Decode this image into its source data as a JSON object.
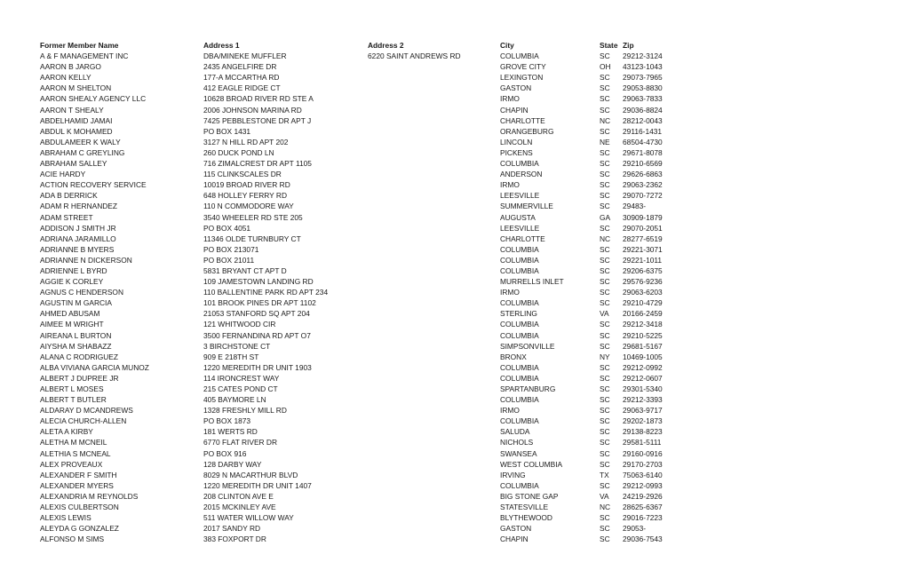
{
  "headers": {
    "name": "Former Member Name",
    "address1": "Address 1",
    "address2": "Address 2",
    "city": "City",
    "state": "State",
    "zip": "Zip"
  },
  "rows": [
    {
      "name": "A & F MANAGEMENT INC",
      "address1": "DBA/MINEKE MUFFLER",
      "address2": "6220 SAINT ANDREWS RD",
      "city": "COLUMBIA",
      "state": "SC",
      "zip": "29212-3124"
    },
    {
      "name": "AARON B JARGO",
      "address1": "2435 ANGELFIRE DR",
      "address2": "",
      "city": "GROVE CITY",
      "state": "OH",
      "zip": "43123-1043"
    },
    {
      "name": "AARON KELLY",
      "address1": "177-A MCCARTHA RD",
      "address2": "",
      "city": "LEXINGTON",
      "state": "SC",
      "zip": "29073-7965"
    },
    {
      "name": "AARON M SHELTON",
      "address1": "412 EAGLE RIDGE CT",
      "address2": "",
      "city": "GASTON",
      "state": "SC",
      "zip": "29053-8830"
    },
    {
      "name": "AARON SHEALY AGENCY LLC",
      "address1": "10628 BROAD RIVER RD STE A",
      "address2": "",
      "city": "IRMO",
      "state": "SC",
      "zip": "29063-7833"
    },
    {
      "name": "AARON T SHEALY",
      "address1": "2006 JOHNSON MARINA RD",
      "address2": "",
      "city": "CHAPIN",
      "state": "SC",
      "zip": "29036-8824"
    },
    {
      "name": "ABDELHAMID JAMAI",
      "address1": "7425 PEBBLESTONE DR APT J",
      "address2": "",
      "city": "CHARLOTTE",
      "state": "NC",
      "zip": "28212-0043"
    },
    {
      "name": "ABDUL K MOHAMED",
      "address1": "PO BOX 1431",
      "address2": "",
      "city": "ORANGEBURG",
      "state": "SC",
      "zip": "29116-1431"
    },
    {
      "name": "ABDULAMEER K WALY",
      "address1": "3127 N HILL RD APT 202",
      "address2": "",
      "city": "LINCOLN",
      "state": "NE",
      "zip": "68504-4730"
    },
    {
      "name": "ABRAHAM C GREYLING",
      "address1": "260 DUCK POND LN",
      "address2": "",
      "city": "PICKENS",
      "state": "SC",
      "zip": "29671-8078"
    },
    {
      "name": "ABRAHAM SALLEY",
      "address1": "716 ZIMALCREST DR APT 1105",
      "address2": "",
      "city": "COLUMBIA",
      "state": "SC",
      "zip": "29210-6569"
    },
    {
      "name": "ACIE HARDY",
      "address1": "115 CLINKSCALES DR",
      "address2": "",
      "city": "ANDERSON",
      "state": "SC",
      "zip": "29626-6863"
    },
    {
      "name": "ACTION RECOVERY SERVICE",
      "address1": "10019 BROAD RIVER RD",
      "address2": "",
      "city": "IRMO",
      "state": "SC",
      "zip": "29063-2362"
    },
    {
      "name": "ADA B DERRICK",
      "address1": "648 HOLLEY FERRY RD",
      "address2": "",
      "city": "LEESVILLE",
      "state": "SC",
      "zip": "29070-7272"
    },
    {
      "name": "ADAM R HERNANDEZ",
      "address1": "110 N COMMODORE WAY",
      "address2": "",
      "city": "SUMMERVILLE",
      "state": "SC",
      "zip": "29483-"
    },
    {
      "name": "ADAM STREET",
      "address1": "3540 WHEELER RD STE 205",
      "address2": "",
      "city": "AUGUSTA",
      "state": "GA",
      "zip": "30909-1879"
    },
    {
      "name": "ADDISON J SMITH JR",
      "address1": "PO BOX 4051",
      "address2": "",
      "city": "LEESVILLE",
      "state": "SC",
      "zip": "29070-2051"
    },
    {
      "name": "ADRIANA JARAMILLO",
      "address1": "11346 OLDE TURNBURY CT",
      "address2": "",
      "city": "CHARLOTTE",
      "state": "NC",
      "zip": "28277-6519"
    },
    {
      "name": "ADRIANNE B MYERS",
      "address1": "PO BOX 213071",
      "address2": "",
      "city": "COLUMBIA",
      "state": "SC",
      "zip": "29221-3071"
    },
    {
      "name": "ADRIANNE N DICKERSON",
      "address1": "PO BOX 21011",
      "address2": "",
      "city": "COLUMBIA",
      "state": "SC",
      "zip": "29221-1011"
    },
    {
      "name": "ADRIENNE L BYRD",
      "address1": "5831 BRYANT CT APT D",
      "address2": "",
      "city": "COLUMBIA",
      "state": "SC",
      "zip": "29206-6375"
    },
    {
      "name": "AGGIE K CORLEY",
      "address1": "109 JAMESTOWN LANDING RD",
      "address2": "",
      "city": "MURRELLS INLET",
      "state": "SC",
      "zip": "29576-9236"
    },
    {
      "name": "AGNUS C HENDERSON",
      "address1": "110 BALLENTINE PARK RD APT 234",
      "address2": "",
      "city": "IRMO",
      "state": "SC",
      "zip": "29063-6203"
    },
    {
      "name": "AGUSTIN M GARCIA",
      "address1": "101 BROOK PINES DR APT 1102",
      "address2": "",
      "city": "COLUMBIA",
      "state": "SC",
      "zip": "29210-4729"
    },
    {
      "name": "AHMED ABUSAM",
      "address1": "21053 STANFORD SQ APT 204",
      "address2": "",
      "city": "STERLING",
      "state": "VA",
      "zip": "20166-2459"
    },
    {
      "name": "AIMEE M WRIGHT",
      "address1": "121 WHITWOOD CIR",
      "address2": "",
      "city": "COLUMBIA",
      "state": "SC",
      "zip": "29212-3418"
    },
    {
      "name": "AIREANA L BURTON",
      "address1": "3500 FERNANDINA RD APT O7",
      "address2": "",
      "city": "COLUMBIA",
      "state": "SC",
      "zip": "29210-5225"
    },
    {
      "name": "AIYSHA M SHABAZZ",
      "address1": "3 BIRCHSTONE CT",
      "address2": "",
      "city": "SIMPSONVILLE",
      "state": "SC",
      "zip": "29681-5167"
    },
    {
      "name": "ALANA C RODRIGUEZ",
      "address1": "909 E 218TH ST",
      "address2": "",
      "city": "BRONX",
      "state": "NY",
      "zip": "10469-1005"
    },
    {
      "name": "ALBA VIVIANA GARCIA MUNOZ",
      "address1": "1220 MEREDITH DR UNIT 1903",
      "address2": "",
      "city": "COLUMBIA",
      "state": "SC",
      "zip": "29212-0992"
    },
    {
      "name": "ALBERT J DUPREE JR",
      "address1": "114 IRONCREST WAY",
      "address2": "",
      "city": "COLUMBIA",
      "state": "SC",
      "zip": "29212-0607"
    },
    {
      "name": "ALBERT L MOSES",
      "address1": "215 CATES POND CT",
      "address2": "",
      "city": "SPARTANBURG",
      "state": "SC",
      "zip": "29301-5340"
    },
    {
      "name": "ALBERT T BUTLER",
      "address1": "405 BAYMORE LN",
      "address2": "",
      "city": "COLUMBIA",
      "state": "SC",
      "zip": "29212-3393"
    },
    {
      "name": "ALDARAY D MCANDREWS",
      "address1": "1328 FRESHLY MILL RD",
      "address2": "",
      "city": "IRMO",
      "state": "SC",
      "zip": "29063-9717"
    },
    {
      "name": "ALECIA CHURCH-ALLEN",
      "address1": "PO BOX 1873",
      "address2": "",
      "city": "COLUMBIA",
      "state": "SC",
      "zip": "29202-1873"
    },
    {
      "name": "ALETA A KIRBY",
      "address1": "181 WERTS RD",
      "address2": "",
      "city": "SALUDA",
      "state": "SC",
      "zip": "29138-8223"
    },
    {
      "name": "ALETHA M MCNEIL",
      "address1": "6770 FLAT RIVER DR",
      "address2": "",
      "city": "NICHOLS",
      "state": "SC",
      "zip": "29581-5111"
    },
    {
      "name": "ALETHIA S MCNEAL",
      "address1": "PO BOX 916",
      "address2": "",
      "city": "SWANSEA",
      "state": "SC",
      "zip": "29160-0916"
    },
    {
      "name": "ALEX PROVEAUX",
      "address1": "128 DARBY WAY",
      "address2": "",
      "city": "WEST COLUMBIA",
      "state": "SC",
      "zip": "29170-2703"
    },
    {
      "name": "ALEXANDER F SMITH",
      "address1": "8029 N MACARTHUR BLVD",
      "address2": "",
      "city": "IRVING",
      "state": "TX",
      "zip": "75063-6140"
    },
    {
      "name": "ALEXANDER MYERS",
      "address1": "1220 MEREDITH DR UNIT 1407",
      "address2": "",
      "city": "COLUMBIA",
      "state": "SC",
      "zip": "29212-0993"
    },
    {
      "name": "ALEXANDRIA M REYNOLDS",
      "address1": "208 CLINTON AVE E",
      "address2": "",
      "city": "BIG STONE GAP",
      "state": "VA",
      "zip": "24219-2926"
    },
    {
      "name": "ALEXIS CULBERTSON",
      "address1": "2015 MCKINLEY AVE",
      "address2": "",
      "city": "STATESVILLE",
      "state": "NC",
      "zip": "28625-6367"
    },
    {
      "name": "ALEXIS LEWIS",
      "address1": "511 WATER WILLOW WAY",
      "address2": "",
      "city": "BLYTHEWOOD",
      "state": "SC",
      "zip": "29016-7223"
    },
    {
      "name": "ALEYDA G GONZALEZ",
      "address1": "2017 SANDY RD",
      "address2": "",
      "city": "GASTON",
      "state": "SC",
      "zip": "29053-"
    },
    {
      "name": "ALFONSO M SIMS",
      "address1": "383 FOXPORT DR",
      "address2": "",
      "city": "CHAPIN",
      "state": "SC",
      "zip": "29036-7543"
    }
  ]
}
